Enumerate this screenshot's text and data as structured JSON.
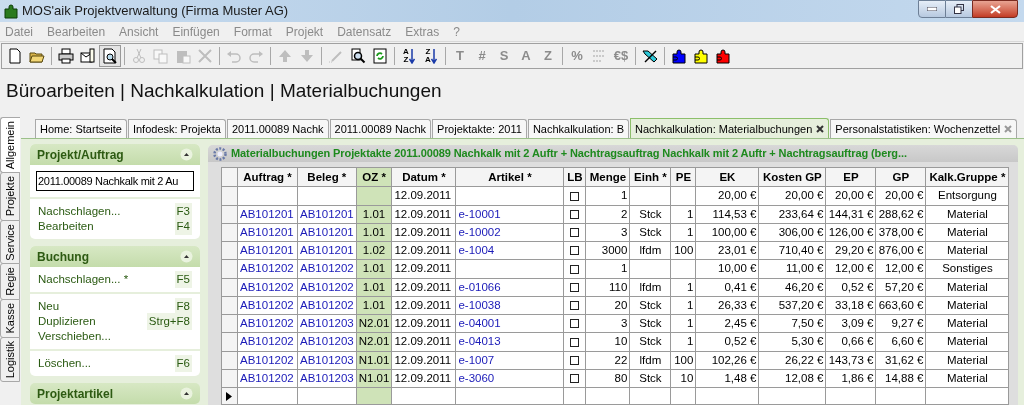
{
  "window": {
    "title": "MOS'aik Projektverwaltung (Firma Muster AG)"
  },
  "menu": [
    "Datei",
    "Bearbeiten",
    "Ansicht",
    "Einfügen",
    "Format",
    "Projekt",
    "Datensatz",
    "Extras",
    "?"
  ],
  "toolbar": [
    {
      "kind": "new",
      "disabled": false,
      "pressed": false
    },
    {
      "kind": "open",
      "disabled": false,
      "pressed": false
    },
    {
      "kind": "sep"
    },
    {
      "kind": "print",
      "disabled": false,
      "pressed": false
    },
    {
      "kind": "mail",
      "disabled": false,
      "pressed": false
    },
    {
      "kind": "preview",
      "disabled": false,
      "pressed": true
    },
    {
      "kind": "sep"
    },
    {
      "kind": "cut",
      "disabled": true,
      "pressed": false
    },
    {
      "kind": "copy",
      "disabled": true,
      "pressed": false
    },
    {
      "kind": "paste",
      "disabled": true,
      "pressed": false
    },
    {
      "kind": "delete",
      "disabled": true,
      "pressed": false
    },
    {
      "kind": "sep"
    },
    {
      "kind": "undo",
      "disabled": true,
      "pressed": false
    },
    {
      "kind": "redo",
      "disabled": true,
      "pressed": false
    },
    {
      "kind": "sep"
    },
    {
      "kind": "up",
      "disabled": true,
      "pressed": false
    },
    {
      "kind": "down",
      "disabled": true,
      "pressed": false
    },
    {
      "kind": "sep"
    },
    {
      "kind": "pen",
      "disabled": true,
      "pressed": false
    },
    {
      "kind": "find",
      "disabled": false,
      "pressed": false
    },
    {
      "kind": "refresh",
      "disabled": false,
      "pressed": false
    },
    {
      "kind": "sep"
    },
    {
      "kind": "sort",
      "top": "A",
      "bottom": "Z",
      "disabled": false,
      "pressed": false
    },
    {
      "kind": "sort",
      "top": "Z",
      "bottom": "A",
      "disabled": false,
      "pressed": false
    },
    {
      "kind": "sep"
    },
    {
      "kind": "glyph",
      "glyph": "T",
      "disabled": true,
      "pressed": false
    },
    {
      "kind": "glyph",
      "glyph": "#",
      "disabled": true,
      "pressed": false
    },
    {
      "kind": "glyph",
      "glyph": "S",
      "disabled": true,
      "pressed": false
    },
    {
      "kind": "glyph",
      "glyph": "A",
      "disabled": true,
      "pressed": false
    },
    {
      "kind": "glyph",
      "glyph": "Z",
      "disabled": true,
      "pressed": false
    },
    {
      "kind": "sep"
    },
    {
      "kind": "glyph",
      "glyph": "%",
      "disabled": true,
      "pressed": false
    },
    {
      "kind": "numbering",
      "disabled": true,
      "pressed": false
    },
    {
      "kind": "glyph",
      "glyph": "€$",
      "disabled": true,
      "pressed": false
    },
    {
      "kind": "sep"
    },
    {
      "kind": "tool",
      "disabled": false,
      "pressed": false
    },
    {
      "kind": "sep"
    },
    {
      "kind": "puzzle",
      "color": "#0000ff",
      "disabled": false,
      "pressed": false
    },
    {
      "kind": "puzzle",
      "color": "#ffff00",
      "disabled": false,
      "pressed": false
    },
    {
      "kind": "puzzle",
      "color": "#ff0000",
      "disabled": false,
      "pressed": false
    }
  ],
  "heading": "Büroarbeiten | Nachkalkulation | Materialbuchungen",
  "side_tabs": [
    {
      "label": "Allgemein",
      "selected": true
    },
    {
      "label": "Projekte",
      "selected": false
    },
    {
      "label": "Service",
      "selected": false
    },
    {
      "label": "Regie",
      "selected": false
    },
    {
      "label": "Kasse",
      "selected": false
    },
    {
      "label": "Logistik",
      "selected": false
    }
  ],
  "tabs": [
    {
      "label": "Home: Startseite",
      "selected": false,
      "closable": false
    },
    {
      "label": "Infodesk: Projekta",
      "selected": false,
      "closable": false
    },
    {
      "label": "2011.00089 Nachk",
      "selected": false,
      "closable": false
    },
    {
      "label": "2011.00089 Nachk",
      "selected": false,
      "closable": false
    },
    {
      "label": "Projektakte: 2011",
      "selected": false,
      "closable": false
    },
    {
      "label": "Nachkalkulation: B",
      "selected": false,
      "closable": false
    },
    {
      "label": "Nachkalkulation: Materialbuchungen",
      "selected": true,
      "closable": true
    },
    {
      "label": "Personalstatistiken: Wochenzettel",
      "selected": false,
      "closable": true
    }
  ],
  "sidebar": [
    {
      "title": "Projekt/Auftrag",
      "field": {
        "value": "2011.00089 Nachkalk mit 2 Au"
      },
      "groups": [
        [
          {
            "label": "Nachschlagen...",
            "shortcut": "F3"
          },
          {
            "label": "Bearbeiten",
            "shortcut": "F4"
          }
        ]
      ]
    },
    {
      "title": "Buchung",
      "groups": [
        [
          {
            "label": "Nachschlagen... *",
            "shortcut": "F5"
          }
        ],
        [
          {
            "label": "Neu",
            "shortcut": "F8"
          },
          {
            "label": "Duplizieren",
            "shortcut": "Strg+F8"
          },
          {
            "label": "Verschieben..."
          }
        ],
        [
          {
            "label": "Löschen...",
            "shortcut": "F6"
          }
        ]
      ]
    },
    {
      "title": "Projektartikel"
    }
  ],
  "panel_title": "Materialbuchungen Projektakte 2011.00089 Nachkalk mit 2 Auftr + Nachtragsauftrag Nachkalk mit 2 Auftr + Nachtragsauftrag (berg...",
  "table": {
    "columns": [
      {
        "label": "Auftrag *",
        "highlighted": false
      },
      {
        "label": "Beleg *",
        "highlighted": false
      },
      {
        "label": "OZ *",
        "highlighted": true
      },
      {
        "label": "Datum *",
        "highlighted": false
      },
      {
        "label": "Artikel *",
        "highlighted": false
      },
      {
        "label": "LB",
        "highlighted": false
      },
      {
        "label": "Menge",
        "highlighted": false
      },
      {
        "label": "Einh *",
        "highlighted": false
      },
      {
        "label": "PE",
        "highlighted": false
      },
      {
        "label": "EK",
        "highlighted": false
      },
      {
        "label": "Kosten GP",
        "highlighted": false
      },
      {
        "label": "EP",
        "highlighted": false
      },
      {
        "label": "GP",
        "highlighted": false
      },
      {
        "label": "Kalk.Gruppe *",
        "highlighted": false
      }
    ],
    "rows": [
      {
        "kind": "data",
        "cells": [
          "",
          "",
          "",
          "12.09.2011",
          "",
          "",
          "1",
          "",
          "",
          "20,00 €",
          "20,00 €",
          "20,00 €",
          "20,00 €",
          "Entsorgung"
        ],
        "lb": false
      },
      {
        "kind": "data",
        "cells": [
          "AB101201",
          "AB101201",
          "1.01",
          "12.09.2011",
          "e-10001",
          "",
          "2",
          "Stck",
          "1",
          "114,53 €",
          "233,64 €",
          "144,31 €",
          "288,62 €",
          "Material"
        ],
        "lb": false
      },
      {
        "kind": "data",
        "cells": [
          "AB101201",
          "AB101201",
          "1.01",
          "12.09.2011",
          "e-10002",
          "",
          "3",
          "Stck",
          "1",
          "100,00 €",
          "306,00 €",
          "126,00 €",
          "378,00 €",
          "Material"
        ],
        "lb": false
      },
      {
        "kind": "data",
        "cells": [
          "AB101201",
          "AB101201",
          "1.02",
          "12.09.2011",
          "e-1004",
          "",
          "3000",
          "lfdm",
          "100",
          "23,01 €",
          "710,40 €",
          "29,20 €",
          "876,00 €",
          "Material"
        ],
        "lb": false
      },
      {
        "kind": "data",
        "cells": [
          "AB101202",
          "AB101202",
          "1.01",
          "12.09.2011",
          "",
          "",
          "1",
          "",
          "",
          "10,00 €",
          "11,00 €",
          "12,00 €",
          "12,00 €",
          "Sonstiges"
        ],
        "lb": false
      },
      {
        "kind": "data",
        "cells": [
          "AB101202",
          "AB101202",
          "1.01",
          "12.09.2011",
          "e-01066",
          "",
          "110",
          "lfdm",
          "1",
          "0,41 €",
          "46,20 €",
          "0,52 €",
          "57,20 €",
          "Material"
        ],
        "lb": false
      },
      {
        "kind": "data",
        "cells": [
          "AB101202",
          "AB101202",
          "1.01",
          "12.09.2011",
          "e-10038",
          "",
          "20",
          "Stck",
          "1",
          "26,33 €",
          "537,20 €",
          "33,18 €",
          "663,60 €",
          "Material"
        ],
        "lb": false
      },
      {
        "kind": "data",
        "cells": [
          "AB101202",
          "AB101203",
          "N2.01",
          "12.09.2011",
          "e-04001",
          "",
          "3",
          "Stck",
          "1",
          "2,45 €",
          "7,50 €",
          "3,09 €",
          "9,27 €",
          "Material"
        ],
        "lb": false
      },
      {
        "kind": "data",
        "cells": [
          "AB101202",
          "AB101203",
          "N2.01",
          "12.09.2011",
          "e-04013",
          "",
          "10",
          "Stck",
          "1",
          "0,52 €",
          "5,30 €",
          "0,66 €",
          "6,60 €",
          "Material"
        ],
        "lb": false
      },
      {
        "kind": "data",
        "cells": [
          "AB101202",
          "AB101203",
          "N1.01",
          "12.09.2011",
          "e-1007",
          "",
          "22",
          "lfdm",
          "100",
          "102,26 €",
          "26,22 €",
          "143,73 €",
          "31,62 €",
          "Material"
        ],
        "lb": false
      },
      {
        "kind": "data",
        "cells": [
          "AB101202",
          "AB101203",
          "N1.01",
          "12.09.2011",
          "e-3060",
          "",
          "80",
          "Stck",
          "10",
          "1,48 €",
          "12,08 €",
          "1,86 €",
          "14,88 €",
          "Material"
        ],
        "lb": false
      },
      {
        "kind": "new"
      }
    ]
  }
}
